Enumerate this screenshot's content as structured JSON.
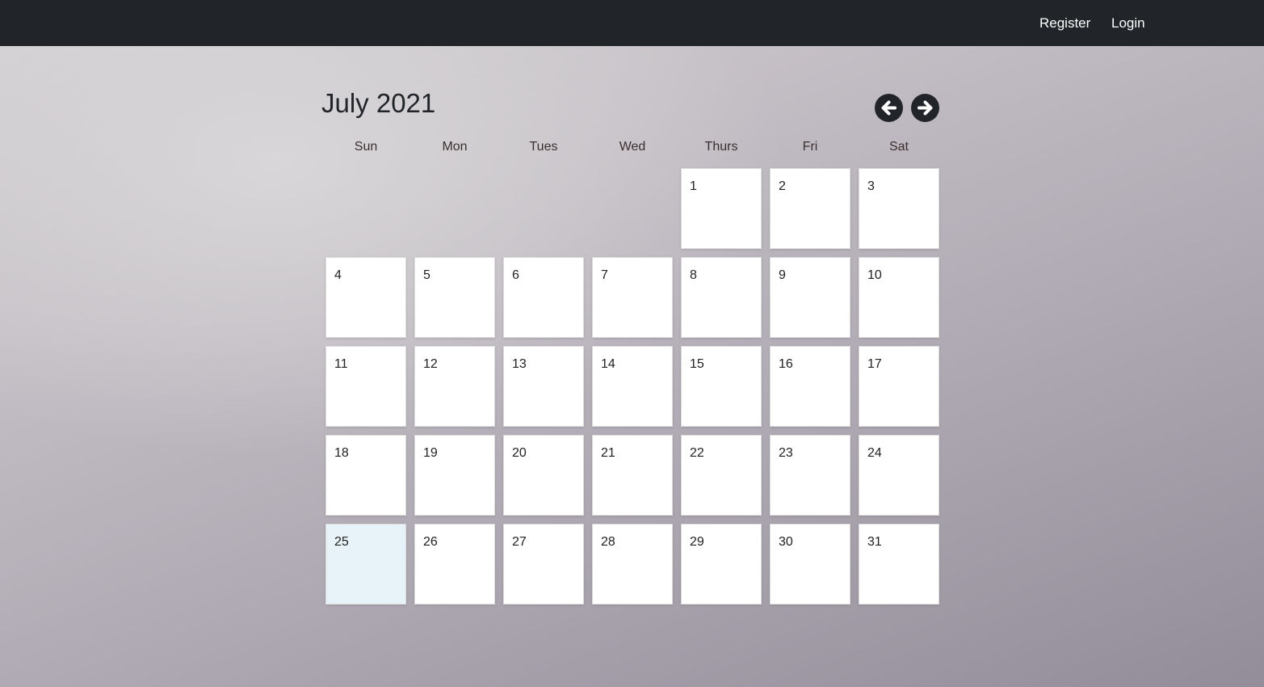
{
  "nav": {
    "links": [
      "Register",
      "Login"
    ],
    "bg_color": "#212529"
  },
  "calendar": {
    "title": "July 2021",
    "prev_icon": "arrow-left-circle-icon",
    "next_icon": "arrow-right-circle-icon",
    "weekdays": [
      "Sun",
      "Mon",
      "Tues",
      "Wed",
      "Thurs",
      "Fri",
      "Sat"
    ],
    "first_weekday_index": 4,
    "days": [
      "1",
      "2",
      "3",
      "4",
      "5",
      "6",
      "7",
      "8",
      "9",
      "10",
      "11",
      "12",
      "13",
      "14",
      "15",
      "16",
      "17",
      "18",
      "19",
      "20",
      "21",
      "22",
      "23",
      "24",
      "25",
      "26",
      "27",
      "28",
      "29",
      "30",
      "31"
    ],
    "highlighted_day": "25",
    "highlight_color": "#e8f3f9"
  }
}
